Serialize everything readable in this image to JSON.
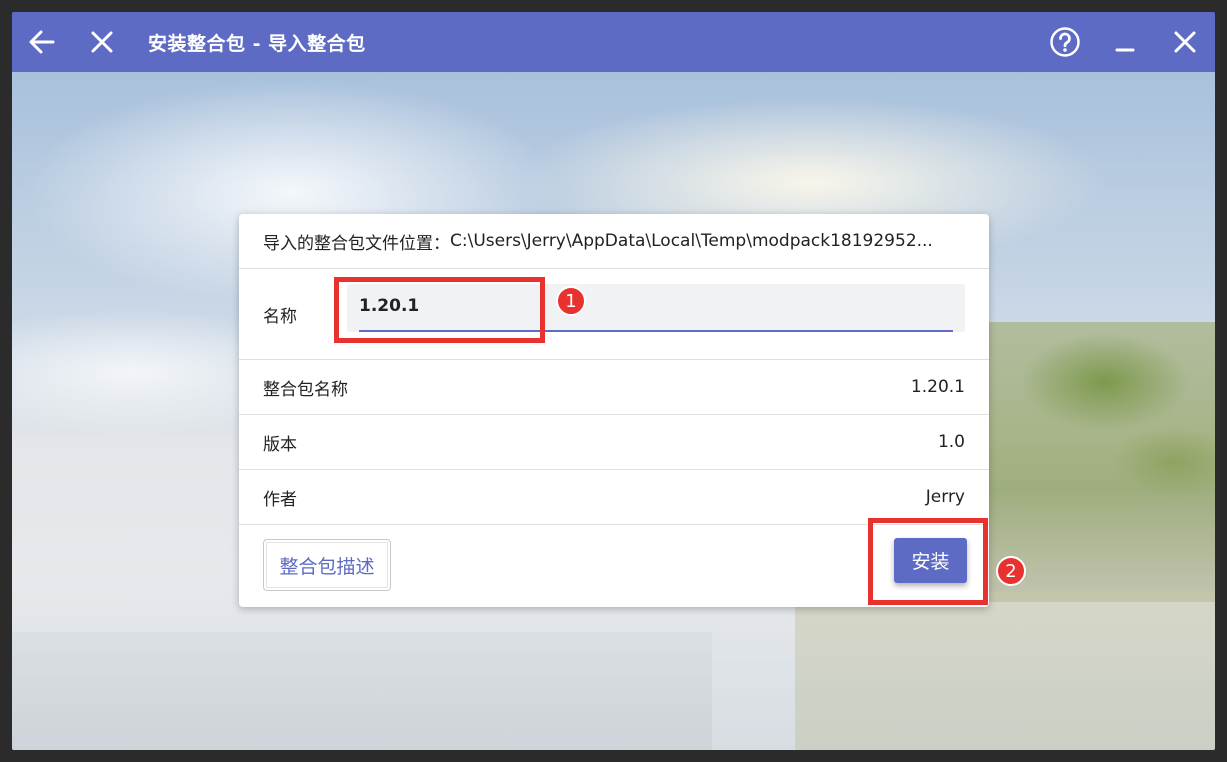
{
  "titlebar": {
    "title": "安装整合包 - 导入整合包",
    "back_icon": "arrow-left-icon",
    "close_page_icon": "close-icon",
    "help_icon": "help-circle-icon",
    "minimize_icon": "minimize-icon",
    "close_window_icon": "close-icon",
    "background": "#5d6bc4"
  },
  "card": {
    "file_location_label": "导入的整合包文件位置：",
    "file_location_value": "C:\\Users\\Jerry\\AppData\\Local\\Temp\\modpack18192952...",
    "name_label": "名称",
    "name_value": "1.20.1",
    "rows": [
      {
        "label": "整合包名称",
        "value": "1.20.1"
      },
      {
        "label": "版本",
        "value": "1.0"
      },
      {
        "label": "作者",
        "value": "Jerry"
      }
    ],
    "description_button": "整合包描述",
    "install_button": "安装"
  },
  "annotations": {
    "marker_1": "1",
    "marker_2": "2",
    "highlight_color": "#e8322f"
  },
  "colors": {
    "accent": "#5d6bc4"
  }
}
